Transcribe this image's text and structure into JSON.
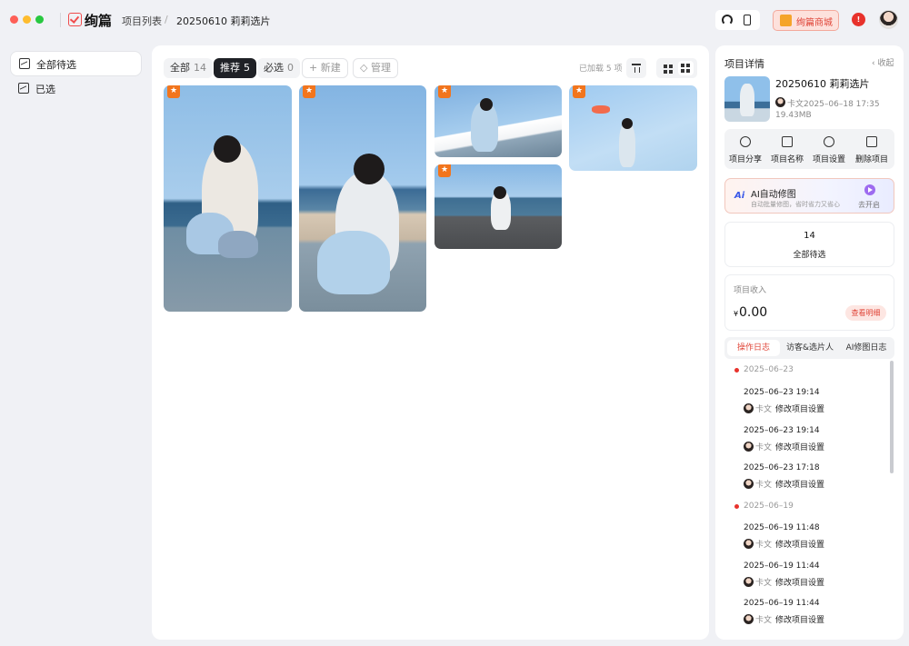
{
  "app": {
    "brand": "绚篇",
    "breadcrumb": [
      "项目列表",
      "/",
      "20250610 莉莉选片"
    ],
    "mall": "绚篇商城",
    "notify_badge": "!"
  },
  "sidebar": {
    "items": [
      {
        "label": "全部待选"
      },
      {
        "label": "已选"
      }
    ]
  },
  "main": {
    "filters": [
      {
        "label": "全部",
        "count": "14"
      },
      {
        "label": "推荐",
        "count": "5"
      },
      {
        "label": "必选",
        "count": "0"
      }
    ],
    "new_label": "+ 新建",
    "manage_label": "管理",
    "loaded": "已加载 5 项",
    "badge": "★"
  },
  "panel": {
    "title": "项目详情",
    "collapse": "收起",
    "project_name": "20250610 莉莉选片",
    "owner_date": "卡文2025–06–18 17:35",
    "size": "19.43MB",
    "actions": [
      {
        "label": "项目分享",
        "icon": "share-icon"
      },
      {
        "label": "项目名称",
        "icon": "edit-icon"
      },
      {
        "label": "项目设置",
        "icon": "gear-icon"
      },
      {
        "label": "删除项目",
        "icon": "trash-icon"
      }
    ],
    "ai": {
      "logo": "Ai",
      "title": "AI自动修图",
      "subtitle": "自动批量修图，省时省力又省心",
      "action": "去开启"
    },
    "count": {
      "value": "14",
      "label": "全部待选"
    },
    "income": {
      "title": "项目收入",
      "currency": "¥",
      "value": "0.00",
      "link": "查看明细"
    },
    "tabs": [
      {
        "label": "操作日志"
      },
      {
        "label": "访客&选片人"
      },
      {
        "label": "AI修图日志"
      }
    ],
    "log": {
      "groups": [
        {
          "date": "2025–06–23",
          "entries": [
            {
              "time": "2025–06–23 19:14",
              "user": "卡文",
              "action": "修改项目设置"
            },
            {
              "time": "2025–06–23 19:14",
              "user": "卡文",
              "action": "修改项目设置"
            },
            {
              "time": "2025–06–23 17:18",
              "user": "卡文",
              "action": "修改项目设置"
            }
          ]
        },
        {
          "date": "2025–06–19",
          "entries": [
            {
              "time": "2025–06–19 11:48",
              "user": "卡文",
              "action": "修改项目设置"
            },
            {
              "time": "2025–06–19 11:44",
              "user": "卡文",
              "action": "修改项目设置"
            },
            {
              "time": "2025–06–19 11:44",
              "user": "卡文",
              "action": "修改项目设置"
            }
          ]
        }
      ]
    }
  }
}
